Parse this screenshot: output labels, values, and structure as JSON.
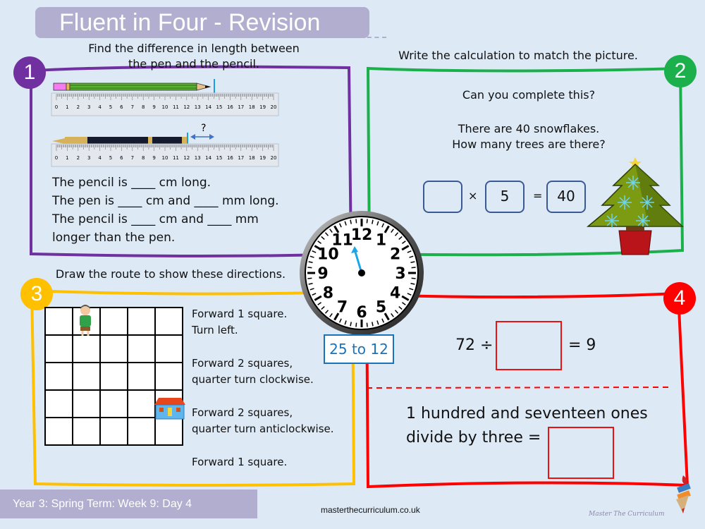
{
  "header": {
    "title": "Fluent in Four - Revision"
  },
  "colors": {
    "q1": "#7030a0",
    "q2": "#1cb04c",
    "q3": "#ffc000",
    "q4": "#ff0000",
    "title_bar": "#b2aed0",
    "clock_label": "#1a73b8"
  },
  "q1": {
    "number": "1",
    "instruction_line1": "Find the difference in length between",
    "instruction_line2": "the pen and the pencil.",
    "ruler_ticks": [
      "0",
      "1",
      "2",
      "3",
      "4",
      "5",
      "6",
      "7",
      "8",
      "9",
      "10",
      "11",
      "12",
      "13",
      "14",
      "15",
      "16",
      "17",
      "18",
      "19",
      "20"
    ],
    "ruler_unit": "cm",
    "question_mark": "?",
    "lines": [
      "The pencil is ____ cm long.",
      "The pen is ____ cm and ____ mm long.",
      "The pencil is ____ cm and ____ mm",
      "longer than the pen."
    ]
  },
  "q2": {
    "number": "2",
    "instruction": "Write the calculation to match the picture.",
    "prompt": "Can you complete this?",
    "story_line1": "There are 40 snowflakes.",
    "story_line2": "How many trees are there?",
    "equation": {
      "box1": "",
      "op": "×",
      "box2": "5",
      "eq": "=",
      "box3": "40"
    }
  },
  "clock": {
    "label": "25 to 12",
    "numbers": [
      "12",
      "1",
      "2",
      "3",
      "4",
      "5",
      "6",
      "7",
      "8",
      "9",
      "10",
      "11"
    ]
  },
  "q3": {
    "number": "3",
    "instruction": "Draw the route to show these directions.",
    "directions": [
      [
        "Forward 1 square.",
        "Turn left."
      ],
      [
        "Forward 2 squares,",
        "quarter turn clockwise."
      ],
      [
        "Forward 2 squares,",
        "quarter turn anticlockwise."
      ],
      [
        "Forward 1 square."
      ]
    ]
  },
  "q4": {
    "number": "4",
    "eq_left": "72 ÷",
    "eq_right": "= 9",
    "word_line1": "1 hundred and seventeen ones",
    "word_line2": "divide by three ="
  },
  "footer": {
    "label": "Year 3: Spring Term: Week 9: Day 4",
    "site": "masterthecurriculum.co.uk",
    "logo_text": "Master The Curriculum"
  }
}
